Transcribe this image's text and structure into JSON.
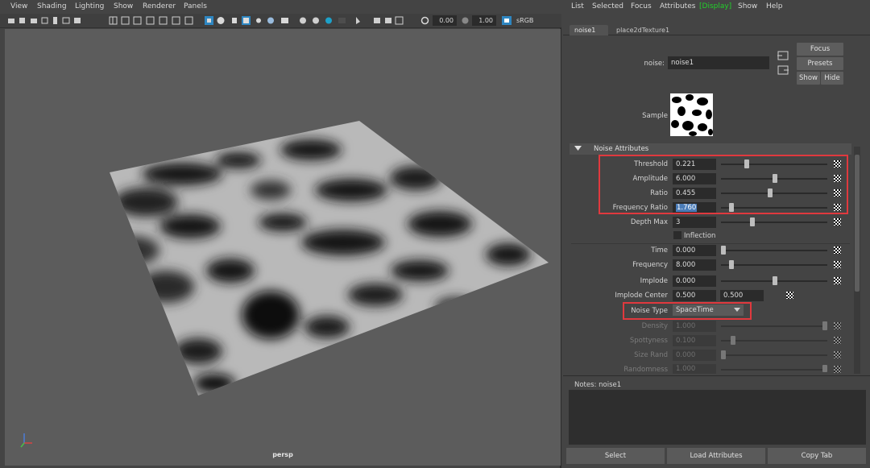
{
  "viewport": {
    "menu": [
      "View",
      "Shading",
      "Lighting",
      "Show",
      "Renderer",
      "Panels"
    ],
    "toolbar": {
      "exposure_value": "0.00",
      "gamma_value": "1.00",
      "color_space": "sRGB gamma"
    },
    "camera_label": "persp",
    "icons": [
      "camera-icon",
      "grid-icon",
      "wireframe-icon",
      "shaded-icon",
      "texture-icon",
      "light-icon",
      "isolate-icon",
      "xray-icon"
    ]
  },
  "attribute_editor": {
    "menu": [
      "List",
      "Selected",
      "Focus",
      "Attributes",
      "[Display]",
      "Show",
      "Help"
    ],
    "tabs": [
      "noise1",
      "place2dTexture1"
    ],
    "node_label": "noise:",
    "node_name": "noise1",
    "buttons": {
      "focus": "Focus",
      "presets": "Presets",
      "show": "Show",
      "hide": "Hide"
    },
    "sample_label": "Sample",
    "section_title": "Noise Attributes",
    "attrs": {
      "threshold": {
        "label": "Threshold",
        "value": "0.221",
        "slider": 0.221
      },
      "amplitude": {
        "label": "Amplitude",
        "value": "6.000",
        "slider": 0.6
      },
      "ratio": {
        "label": "Ratio",
        "value": "0.455",
        "slider": 0.455
      },
      "frequency_ratio": {
        "label": "Frequency Ratio",
        "value": "1.760",
        "slider": 0.1
      },
      "depth_max": {
        "label": "Depth Max",
        "value": "3",
        "slider": 0.3
      },
      "inflection": {
        "label": "Inflection"
      },
      "time": {
        "label": "Time",
        "value": "0.000",
        "slider": 0.0
      },
      "frequency": {
        "label": "Frequency",
        "value": "8.000",
        "slider": 0.08
      },
      "implode": {
        "label": "Implode",
        "value": "0.000",
        "slider": 0.5
      },
      "implode_center": {
        "label": "Implode Center",
        "value_u": "0.500",
        "value_v": "0.500"
      },
      "noise_type": {
        "label": "Noise Type",
        "value": "SpaceTime"
      },
      "density": {
        "label": "Density",
        "value": "1.000",
        "slider": 1.0
      },
      "spottyness": {
        "label": "Spottyness",
        "value": "0.100",
        "slider": 0.1
      },
      "size_rand": {
        "label": "Size Rand",
        "value": "0.000",
        "slider": 0.0
      },
      "randomness": {
        "label": "Randomness",
        "value": "1.000",
        "slider": 1.0
      }
    },
    "notes_label": "Notes:  noise1",
    "bottom_buttons": [
      "Select",
      "Load Attributes",
      "Copy Tab"
    ],
    "colors": {
      "display_highlight": "#22d12a",
      "highlight_box": "#e0393e",
      "selection": "#4a7cb8"
    }
  }
}
